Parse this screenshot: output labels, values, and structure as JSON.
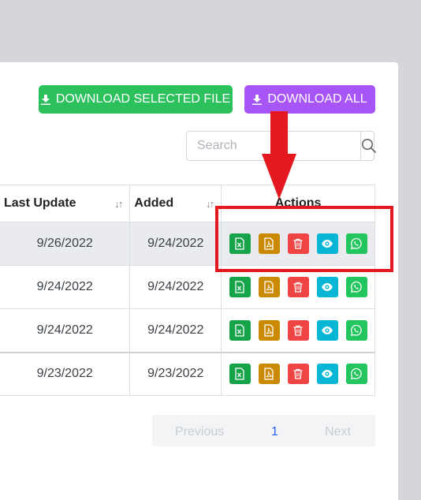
{
  "toolbar": {
    "download_selected_label": "DOWNLOAD SELECTED FILE",
    "download_all_label": "DOWNLOAD ALL"
  },
  "search": {
    "placeholder": "Search",
    "icon": "search-icon"
  },
  "table": {
    "columns": [
      "Last Update",
      "Added",
      "Actions"
    ],
    "rows": [
      {
        "last_update": "9/26/2022",
        "added": "9/24/2022"
      },
      {
        "last_update": "9/24/2022",
        "added": "9/24/2022"
      },
      {
        "last_update": "9/24/2022",
        "added": "9/24/2022"
      },
      {
        "last_update": "9/23/2022",
        "added": "9/23/2022"
      }
    ],
    "action_icons": [
      "excel-icon",
      "pdf-icon",
      "trash-icon",
      "eye-icon",
      "whatsapp-icon"
    ]
  },
  "pagination": {
    "previous": "Previous",
    "current": "1",
    "next": "Next"
  },
  "colors": {
    "green": "#2dc15e",
    "purple": "#a855f7",
    "excel": "#16a34a",
    "pdf": "#ca8a04",
    "delete": "#ef4444",
    "view": "#06b6d4",
    "whatsapp": "#22c55e",
    "annotation": "#e3191f"
  }
}
